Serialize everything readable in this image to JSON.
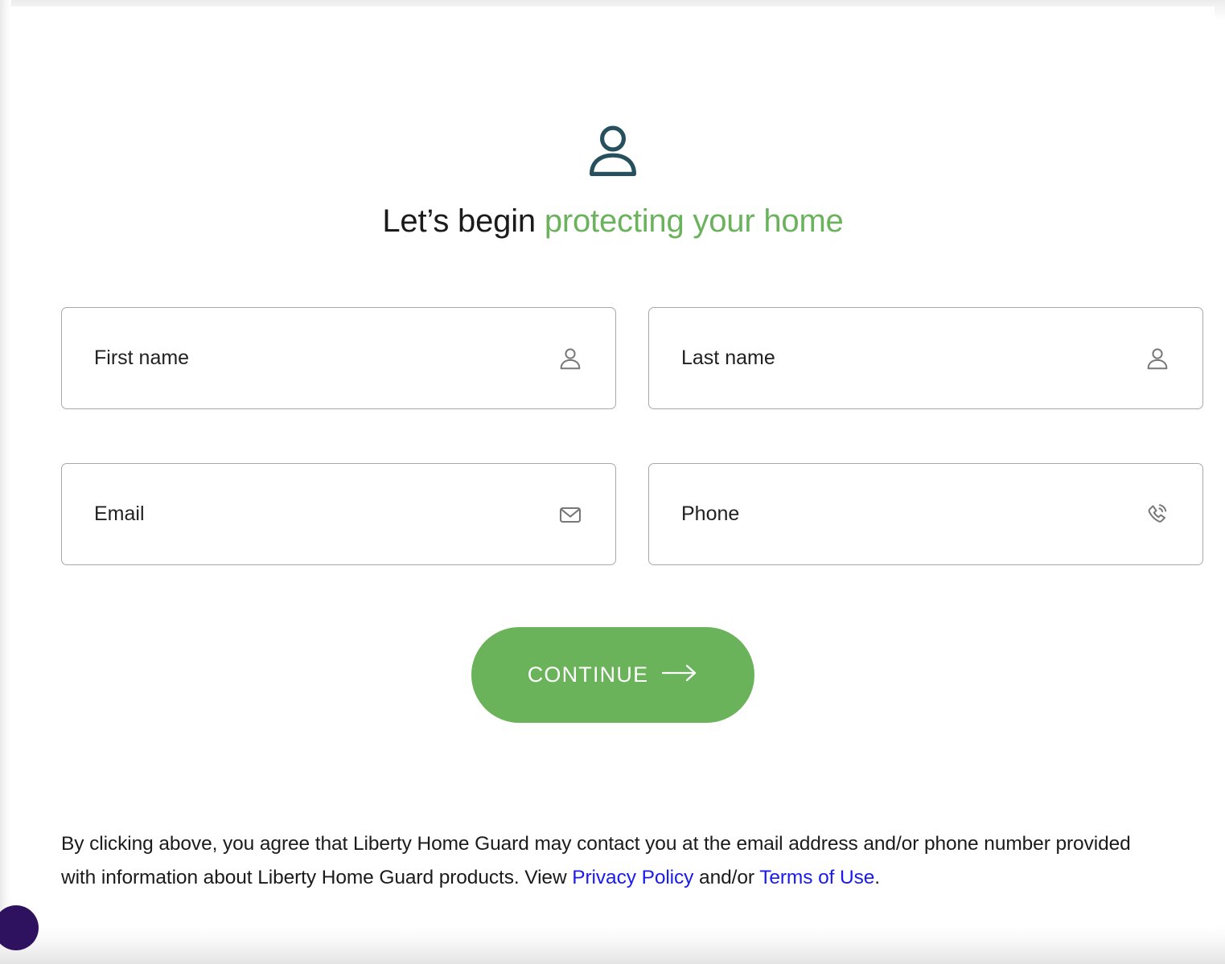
{
  "header": {
    "icon": "person-icon",
    "headline_lead": "Let’s begin ",
    "headline_accent": "protecting your home"
  },
  "form": {
    "fields": [
      {
        "name": "first-name",
        "label": "First name",
        "placeholder": "First name",
        "value": "",
        "icon": "person-icon"
      },
      {
        "name": "last-name",
        "label": "Last name",
        "placeholder": "Last name",
        "value": "",
        "icon": "person-icon"
      },
      {
        "name": "email",
        "label": "Email",
        "placeholder": "Email",
        "value": "",
        "icon": "envelope-icon"
      },
      {
        "name": "phone",
        "label": "Phone",
        "placeholder": "Phone",
        "value": "",
        "icon": "phone-in-talk-icon"
      }
    ]
  },
  "cta": {
    "label": "CONTINUE",
    "icon": "arrow-right-icon"
  },
  "disclaimer": {
    "part1": "By clicking above, you agree that Liberty Home Guard may contact you at the email address and/or phone number provided with information about Liberty Home Guard products. View ",
    "link1": "Privacy Policy",
    "part2": " and/or ",
    "link2": "Terms of Use",
    "part3": "."
  },
  "colors": {
    "brand_green": "#6ab35a",
    "accent_green": "#6ab35c",
    "heading_dark": "#1b1b1b",
    "icon_dark_teal": "#27505e",
    "field_border": "#a8a8a8",
    "field_icon": "#787878",
    "link_blue": "#1a1aee",
    "widget_purple": "#2e1260"
  }
}
